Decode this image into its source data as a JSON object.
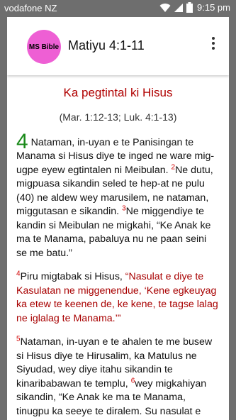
{
  "status_bar": {
    "carrier": "vodafone NZ",
    "time": "9:15 pm",
    "icons": [
      "wifi-icon",
      "signal-icon",
      "battery-icon"
    ]
  },
  "app_bar": {
    "logo_text": "MS Bible",
    "title": "Matiyu 4:1-11",
    "menu_icon": "overflow-menu-icon"
  },
  "colors": {
    "heading_red": "#b00000",
    "chapter_green": "#1a8a1a",
    "verse_number_red": "#d00000",
    "logo_pink": "#ee5fd4"
  },
  "content": {
    "heading": "Ka pegtintal ki Hisus",
    "cross_refs": "(Mar. 1:12-13; Luk. 4:1-13)",
    "chapter_number": "4",
    "verse1": "Nataman, in-uyan e te Panisingan te Manama si Hisus diye te inged ne ware mig-ugpe eyew egtintalen ni Meibulan.",
    "verse2_num": "2",
    "verse2": "Ne dutu, migpuasa sikandin seled te hep-at ne pulu (40) ne aldew wey marusilem, ne nataman, miggutasan e sikandin.",
    "verse3_num": "3",
    "verse3": "Ne miggendiye te kandin si Meibulan ne migkahi, “Ke Anak ke ma te Manama, pabaluya nu ne paan seini se me batu.”",
    "verse4_num": "4",
    "verse4_plain": "Piru migtabak si Hisus, ",
    "verse4_red": "“Nasulat e diye te Kasulatan ne miggenendue, ‘Kene egkeuyag ka etew te keenen de, ke kene, te tagse lalag ne iglalag te Manama.’”",
    "verse5_num": "5",
    "verse5": "Nataman, in-uyan e te ahalen te me busew si Hisus diye te Hirusalim, ka Matulus ne Siyudad, wey diye itahu sikandin te kinaribabawan te templu,",
    "verse6_num": "6",
    "verse6": "wey migkahiyan sikandin, “Ke Anak ke ma te Manama, tinugpu ka seeye te diralem. Su nasulat e diye te Kasulatan,"
  }
}
